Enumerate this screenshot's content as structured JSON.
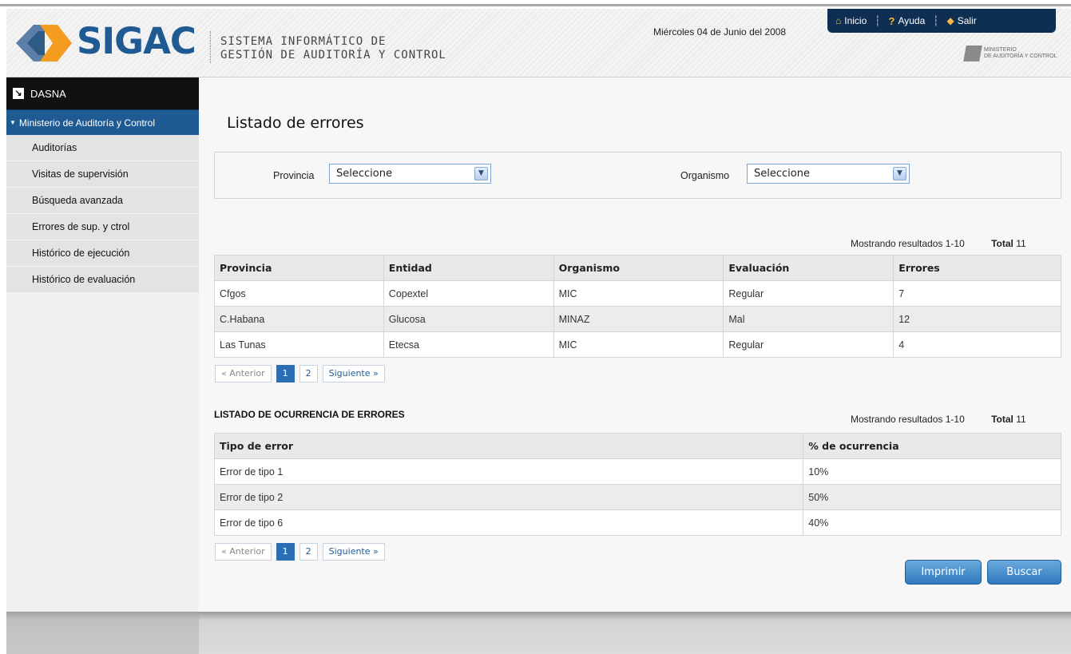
{
  "header": {
    "logo_text": "SIGAC",
    "system_name_line1": "SISTEMA INFORMÁTICO DE",
    "system_name_line2": "GESTIÓN DE AUDITORÍA Y CONTROL",
    "date": "Miércoles 04 de Junio del 2008",
    "nav": {
      "inicio": "Inicio",
      "ayuda": "Ayuda",
      "salir": "Salir"
    },
    "ministry_line1": "MINISTERIO",
    "ministry_line2": "DE AUDITORÍA Y CONTROL"
  },
  "sidebar": {
    "top_label": "DASNA",
    "section": "Ministerio de Auditoría y Control",
    "items": [
      {
        "label": "Auditorías"
      },
      {
        "label": "Visitas de supervisión"
      },
      {
        "label": "Búsqueda avanzada"
      },
      {
        "label": "Errores de sup. y ctrol"
      },
      {
        "label": "Histórico de ejecución"
      },
      {
        "label": "Histórico de evaluación"
      }
    ]
  },
  "main": {
    "title": "Listado de errores",
    "filters": {
      "provincia_label": "Provincia",
      "provincia_value": "Seleccione",
      "organismo_label": "Organismo",
      "organismo_value": "Seleccione"
    },
    "errors_table": {
      "results_text": "Mostrando resultados 1-10",
      "total_text": "Total",
      "total_value": "11",
      "columns": [
        "Provincia",
        "Entidad",
        "Organismo",
        "Evaluación",
        "Errores"
      ],
      "rows": [
        [
          "Cfgos",
          "Copextel",
          "MIC",
          "Regular",
          "7"
        ],
        [
          "C.Habana",
          "Glucosa",
          "MINAZ",
          "Mal",
          "12"
        ],
        [
          "Las Tunas",
          "Etecsa",
          "MIC",
          "Regular",
          "4"
        ]
      ]
    },
    "pager": {
      "prev": "« Anterior",
      "page1": "1",
      "page2": "2",
      "next": "Siguiente »"
    },
    "occurrence": {
      "heading": "LISTADO DE OCURRENCIA DE ERRORES",
      "results_text": "Mostrando resultados 1-10",
      "total_text": "Total",
      "total_value": "11",
      "columns": [
        "Tipo de error",
        "% de ocurrencia"
      ],
      "rows": [
        [
          "Error de tipo 1",
          "10%"
        ],
        [
          "Error de tipo 2",
          "50%"
        ],
        [
          "Error de tipo 6",
          "40%"
        ]
      ]
    },
    "buttons": {
      "print": "Imprimir",
      "search": "Buscar"
    }
  }
}
